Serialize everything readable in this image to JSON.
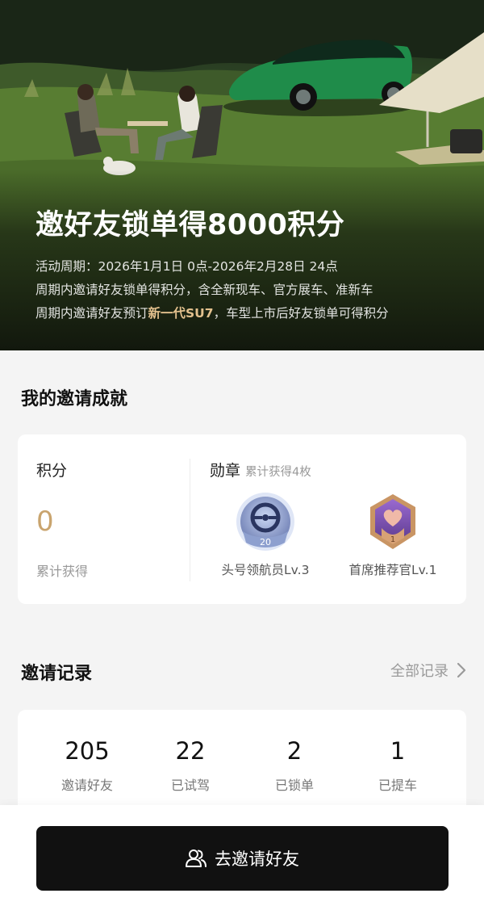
{
  "hero": {
    "title": "邀好友锁单得8000积分",
    "line1": "活动周期：2026年1月1日 0点-2026年2月28日 24点",
    "line2": "周期内邀请好友锁单得积分，含全新现车、官方展车、准新车",
    "line3_prefix": "周期内邀请好友预订",
    "line3_highlight": "新一代SU7",
    "line3_suffix": "，车型上市后好友锁单可得积分"
  },
  "achievements": {
    "title": "我的邀请成就",
    "points_label": "积分",
    "points_value": "0",
    "points_sub": "累计获得",
    "medals_label": "勋章",
    "medals_sub": "累计获得4枚",
    "medals": [
      {
        "name": "头号领航员Lv.3",
        "icon": "steering-wheel-medal-icon",
        "badge": "20"
      },
      {
        "name": "首席推荐官Lv.1",
        "icon": "heart-hexagon-medal-icon",
        "badge": "1"
      }
    ]
  },
  "records": {
    "title": "邀请记录",
    "all_link": "全部记录",
    "stats": [
      {
        "value": "205",
        "label": "邀请好友"
      },
      {
        "value": "22",
        "label": "已试驾"
      },
      {
        "value": "2",
        "label": "已锁单"
      },
      {
        "value": "1",
        "label": "已提车"
      }
    ]
  },
  "cta": {
    "label": "去邀请好友",
    "icon": "users-icon"
  },
  "colors": {
    "accent_gold": "#c9a46e",
    "highlight_gold": "#e3c18e",
    "cta_bg": "#111111",
    "page_bg": "#f4f4f4"
  }
}
